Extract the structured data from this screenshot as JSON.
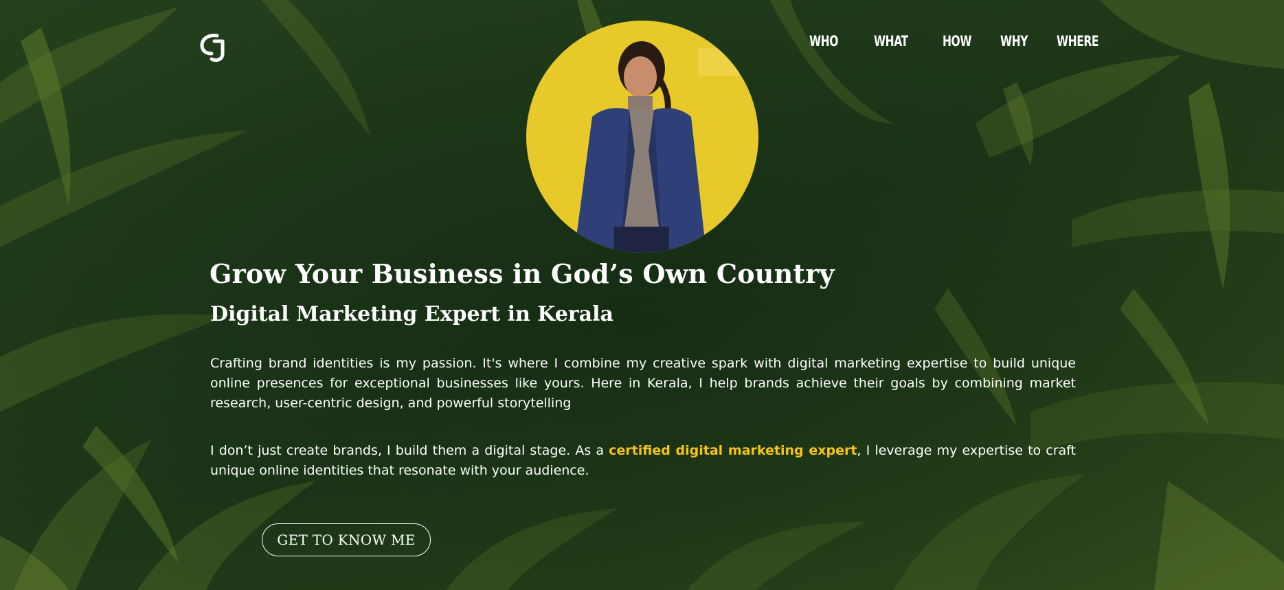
{
  "brand": {
    "logo_icon": "cj-monogram-icon",
    "logo_text": "CJ"
  },
  "nav": {
    "items": [
      {
        "label": "WHO"
      },
      {
        "label": "WHAT"
      },
      {
        "label": "HOW"
      },
      {
        "label": "WHY"
      },
      {
        "label": "WHERE"
      }
    ]
  },
  "hero": {
    "portrait_icon": "profile-photo",
    "title": "Grow Your Business in God’s Own Country",
    "subtitle": "Digital Marketing Expert in Kerala",
    "paragraph1": "Crafting brand identities is my passion. It's where I combine my creative spark with digital marketing expertise to build unique online presences for exceptional businesses like yours. Here in Kerala, I help brands achieve their goals by combining market research, user-centric design, and powerful storytelling",
    "paragraph2_before": "I don’t just create brands, I build them a digital stage. As a ",
    "paragraph2_link": "certified digital marketing expert",
    "paragraph2_after": ", I leverage my expertise to craft unique online identities that resonate with your audience.",
    "cta_label": "GET TO KNOW ME"
  },
  "colors": {
    "background": "#1f3a1a",
    "accent": "#f6c518",
    "portrait_bg": "#e8c92a",
    "text": "#ffffff"
  }
}
